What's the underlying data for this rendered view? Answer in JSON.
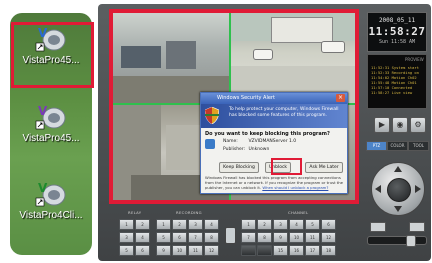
{
  "desktop": {
    "icons": [
      {
        "label": "VistaPro45...",
        "icon": "vistapro-app-icon",
        "selected": true
      },
      {
        "label": "VistaPro45...",
        "icon": "vistapro-app-icon",
        "selected": false
      },
      {
        "label": "VistaPro4Cli...",
        "icon": "vistapro-client-icon",
        "selected": false
      }
    ]
  },
  "firewall_dialog": {
    "title": "Windows Security Alert",
    "banner": "To help protect your computer, Windows Firewall has blocked some features of this program.",
    "question": "Do you want to keep blocking this program?",
    "name_label": "Name:",
    "name_value": "VZVIDMANServer 1.0",
    "publisher_label": "Publisher:",
    "publisher_value": "Unknown",
    "buttons": {
      "keep_blocking": "Keep Blocking",
      "unblock": "Unblock",
      "ask_later": "Ask Me Later"
    },
    "footer": "Windows Firewall has blocked this program from accepting connections from the Internet or a network. If you recognize the program or trust the publisher, you can unblock it.",
    "footer_link": "When should I unblock a program?",
    "highlight_color": "#e01b36"
  },
  "clock": {
    "date": "2008_05_11",
    "time": "11:58:27",
    "sub": "Sun 11:58 AM"
  },
  "log": {
    "lines": [
      "11:52:31 System start",
      "11:52:33 Recording on",
      "11:54:02 Motion Ch02",
      "11:55:48 Motion Ch01",
      "11:57:10 Connected",
      "11:58:27 Live view"
    ],
    "logo": "PROVIEW"
  },
  "tabs": [
    "PTZ",
    "COLOR",
    "TOOL"
  ],
  "control_labels": {
    "relay": "RELAY",
    "recording": "RECORDING",
    "channel": "CHANNEL"
  },
  "colors": {
    "accent_red": "#e01b36",
    "grid_green": "#2fc04d",
    "panel": "#4a4e50"
  }
}
